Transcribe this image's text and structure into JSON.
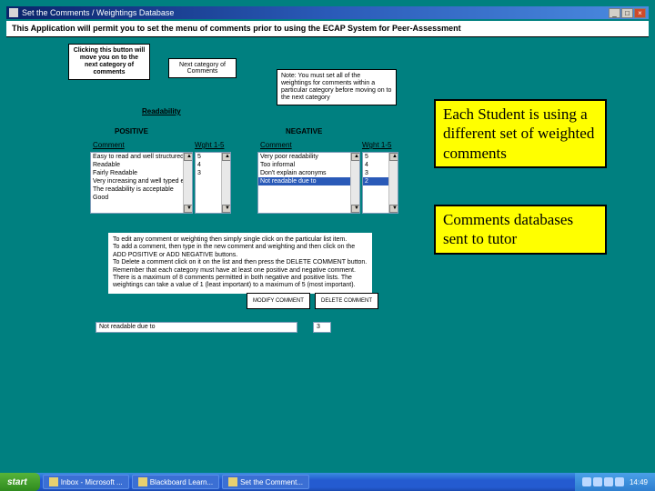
{
  "window": {
    "title": "Set the Comments / Weightings Database"
  },
  "desc": "This Application will permit you to set the menu of comments prior to using the ECAP System for Peer-Assessment",
  "info_move_on": "Clicking this button will move you on to the next category of comments",
  "btn_next_category": "Next category of Comments",
  "note_box": "Note: You must set all of the weightings for comments within a particular category before moving on to the next category",
  "section_label": "Readability",
  "positive_hdr": "POSITIVE",
  "negative_hdr": "NEGATIVE",
  "col_comment": "Comment",
  "col_weight": "Wght 1-5",
  "pos_list": [
    "Easy to read and well structured",
    "Readable",
    "Fairly Readable",
    "Very increasing and well typed essek",
    "The readability is acceptable",
    "Good"
  ],
  "pos_weights": [
    "5",
    "4",
    "3",
    "",
    ""
  ],
  "neg_list": [
    "Very poor readability",
    "Too informal",
    "Don't explain acronyms",
    "Not readable due to"
  ],
  "neg_weights": [
    "5",
    "4",
    "3",
    "2"
  ],
  "neg_selected_idx": 3,
  "instructions": "To edit any comment or weighting then simply single click on the particular list item.\nTo add a comment, then type in the new comment and weighting and then click on the ADD POSITIVE or ADD NEGATIVE buttons.\nTo Delete a comment click on it on the list and then press the DELETE COMMENT button.\nRemember that each category must have at least one positive and negative comment. There is a maximum of 8 comments permitted in both negative and positive lists. The weightings can take a value of 1 (least important) to a maximum of 5 (most important).",
  "btn_modify": "MODIFY COMMENT",
  "btn_delete": "DELETE COMMENT",
  "bottom_input": "Not readable due to",
  "bottom_weight": "3",
  "callout1": "Each Student is using a different set of weighted comments",
  "callout2": "Comments databases sent to tutor",
  "taskbar": {
    "start": "start",
    "items": [
      "Inbox - Microsoft ...",
      "Blackboard Learn...",
      "Set the Comment..."
    ],
    "time": "14:49"
  }
}
